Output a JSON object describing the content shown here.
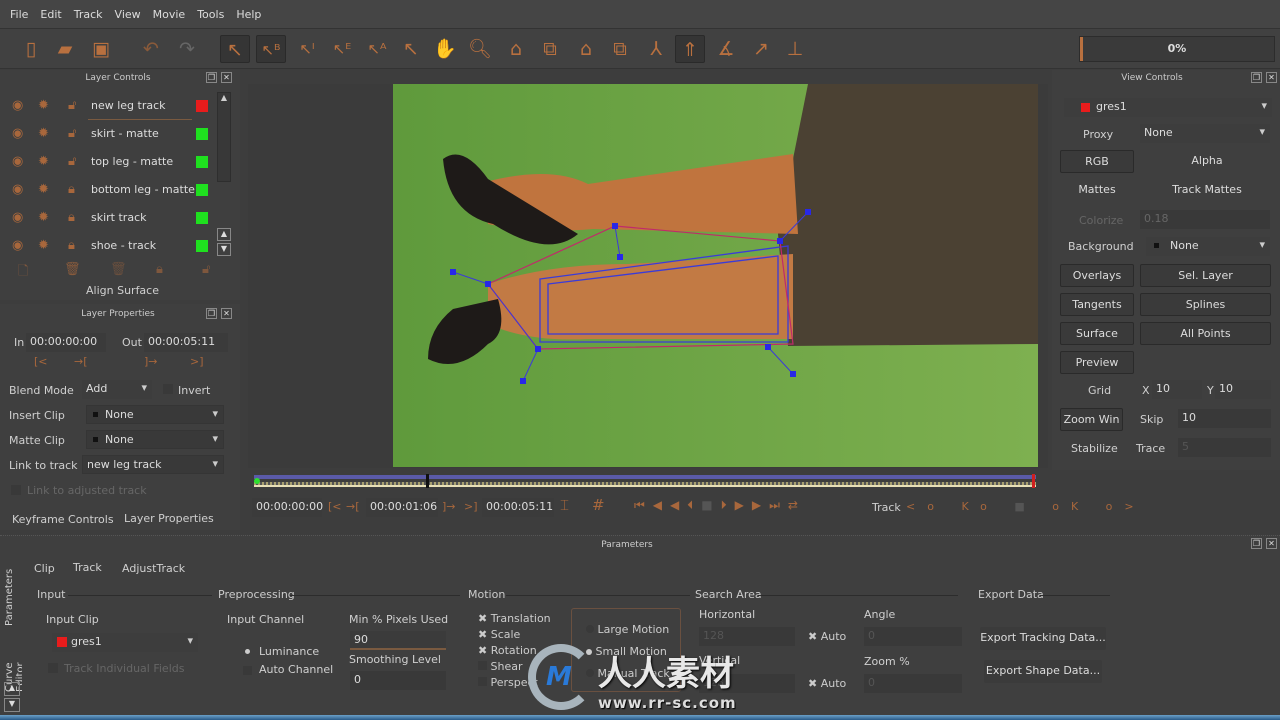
{
  "menu": [
    "File",
    "Edit",
    "Track",
    "View",
    "Movie",
    "Tools",
    "Help"
  ],
  "toolbar": {
    "icons": [
      "new-file",
      "open-folder",
      "save",
      "undo",
      "redo",
      "pick-tool",
      "pick-b-tool",
      "pick-i-tool",
      "pick-e-tool",
      "pick-a-tool",
      "add-point-tool",
      "hand-tool",
      "zoom-tool",
      "x-spline-tool",
      "add-x-spline-tool",
      "bezier-tool",
      "add-bezier-tool",
      "magnetic-tool",
      "surface-tool",
      "align-tool",
      "transform-tool",
      "axis-tool"
    ],
    "progress": "0%",
    "progress_value": 0
  },
  "layer_controls": {
    "title": "Layer Controls",
    "layers": [
      {
        "name": "new leg track",
        "color": "#e81c1c"
      },
      {
        "name": "skirt - matte",
        "color": "#1fe01f"
      },
      {
        "name": "top leg - matte",
        "color": "#1fe01f"
      },
      {
        "name": "bottom leg - matte",
        "color": "#1fe01f"
      },
      {
        "name": "skirt track",
        "color": "#1fe01f"
      },
      {
        "name": "shoe - track",
        "color": "#1fe01f"
      }
    ],
    "align_surface": "Align Surface"
  },
  "layer_properties": {
    "title": "Layer Properties",
    "in_label": "In",
    "in_value": "00:00:00:00",
    "out_label": "Out",
    "out_value": "00:00:05:11",
    "blend_mode_label": "Blend Mode",
    "blend_mode": "Add",
    "invert": "Invert",
    "insert_clip_label": "Insert Clip",
    "insert_clip": "None",
    "matte_clip_label": "Matte Clip",
    "matte_clip": "None",
    "link_label": "Link to track",
    "link": "new leg track",
    "link_adjusted": "Link to adjusted track",
    "tabs": [
      "Keyframe Controls",
      "Layer Properties"
    ]
  },
  "view_controls": {
    "title": "View Controls",
    "clip": "gres1",
    "clip_color": "#e81c1c",
    "proxy_label": "Proxy",
    "proxy": "None",
    "rgb": "RGB",
    "alpha": "Alpha",
    "mattes": "Mattes",
    "track_mattes": "Track Mattes",
    "colorize": "Colorize",
    "colorize_value": "0.18",
    "background_label": "Background",
    "background": "None",
    "overlays": "Overlays",
    "sel_layer": "Sel. Layer",
    "tangents": "Tangents",
    "splines": "Splines",
    "surface": "Surface",
    "all_points": "All Points",
    "preview": "Preview",
    "grid": "Grid",
    "grid_x_label": "X",
    "grid_x": "10",
    "grid_y_label": "Y",
    "grid_y": "10",
    "zoom_win": "Zoom Win",
    "skip_label": "Skip",
    "skip": "10",
    "stabilize": "Stabilize",
    "trace_label": "Trace",
    "trace": "5"
  },
  "timeline": {
    "start": "00:00:00:00",
    "current": "00:00:01:06",
    "end": "00:00:05:11",
    "track_label": "Track",
    "playhead_fraction": 0.22
  },
  "parameters": {
    "title": "Parameters",
    "side_tabs": [
      "Parameters",
      "Curve Editor"
    ],
    "tabs": [
      "Clip",
      "Track",
      "AdjustTrack"
    ],
    "active_tab": "Track",
    "input": {
      "title": "Input",
      "clip_label": "Input Clip",
      "clip": "gres1",
      "clip_color": "#e81c1c",
      "fields": "Track Individual Fields"
    },
    "preprocessing": {
      "title": "Preprocessing",
      "channel_label": "Input Channel",
      "luminance": "Luminance",
      "auto_channel": "Auto Channel",
      "min_pixels_label": "Min % Pixels Used",
      "min_pixels": "90",
      "smoothing_label": "Smoothing Level",
      "smoothing": "0"
    },
    "motion": {
      "title": "Motion",
      "translation": "Translation",
      "scale": "Scale",
      "rotation": "Rotation",
      "shear": "Shear",
      "perspective": "Perspective",
      "large": "Large Motion",
      "small": "Small Motion",
      "manual": "Manual Track"
    },
    "search": {
      "title": "Search Area",
      "horizontal_label": "Horizontal",
      "horizontal": "128",
      "vertical_label": "Vertical",
      "vertical": "128",
      "auto": "Auto",
      "angle_label": "Angle",
      "angle": "0",
      "zoom_label": "Zoom %",
      "zoom": "0"
    },
    "export": {
      "title": "Export Data",
      "tracking": "Export Tracking Data...",
      "shape": "Export Shape Data..."
    }
  },
  "watermark": {
    "text": "人人素材",
    "url": "www.rr-sc.com"
  }
}
